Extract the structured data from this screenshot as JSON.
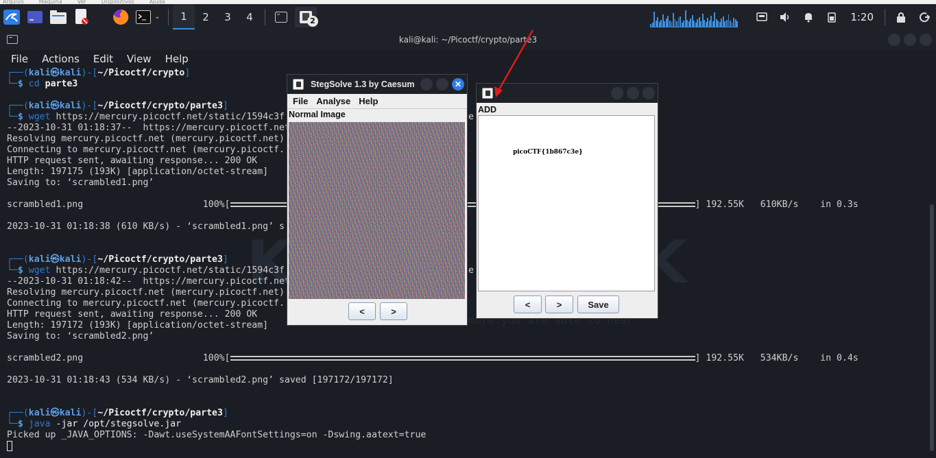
{
  "vbox_menu": [
    "Arquivo",
    "Máquina",
    "Ver",
    "Dispositivos",
    "Ajuda"
  ],
  "panel": {
    "workspaces": [
      "1",
      "2",
      "3",
      "4"
    ],
    "active_workspace": "1",
    "app_badge": "2",
    "clock": "1:20",
    "accent": "#3d8fe0",
    "netgraph": [
      4,
      6,
      22,
      9,
      14,
      7,
      10,
      18,
      8,
      12,
      16,
      9,
      7,
      20,
      11,
      8,
      13,
      15,
      6,
      9,
      24,
      10,
      8,
      12,
      17,
      9,
      6,
      11,
      14,
      8,
      19,
      10,
      7,
      13,
      9,
      16,
      8,
      21,
      11,
      9,
      7,
      12,
      15,
      8,
      10,
      18,
      9,
      6,
      13,
      11,
      8
    ]
  },
  "terminal": {
    "title": "kali@kali: ~/Picoctf/crypto/parte3",
    "menu": [
      "File",
      "Actions",
      "Edit",
      "View",
      "Help"
    ],
    "lines": [
      {
        "k": "prompt",
        "path": "~/Picoctf/crypto",
        "cmd": "cd",
        "arg": "parte3"
      },
      {
        "k": "blank"
      },
      {
        "k": "prompt",
        "path": "~/Picoctf/crypto/parte3",
        "cmd": "wget",
        "arg": "https://mercury.picoctf.net/static/1594c3f"
      },
      {
        "k": "text",
        "t": "--2023-10-31 01:18:37--  https://mercury.picoctf.net"
      },
      {
        "k": "text",
        "t": "Resolving mercury.picoctf.net (mercury.picoctf.net)"
      },
      {
        "k": "text",
        "t": "Connecting to mercury.picoctf.net (mercury.picoctf."
      },
      {
        "k": "text",
        "t": "HTTP request sent, awaiting response... 200 OK"
      },
      {
        "k": "text",
        "t": "Length: 197175 (193K) [application/octet-stream]"
      },
      {
        "k": "text",
        "t": "Saving to: ‘scrambled1.png’"
      },
      {
        "k": "blank"
      },
      {
        "k": "progress",
        "t": "scrambled1.png                      100%[",
        "end": "] 192.55K   610KB/s    in 0.3s"
      },
      {
        "k": "blank"
      },
      {
        "k": "text",
        "t": "2023-10-31 01:18:38 (610 KB/s) - ‘scrambled1.png’ s"
      },
      {
        "k": "blank"
      },
      {
        "k": "blank"
      },
      {
        "k": "prompt",
        "path": "~/Picoctf/crypto/parte3",
        "cmd": "wget",
        "arg": "https://mercury.picoctf.net/static/1594c3f"
      },
      {
        "k": "text",
        "t": "--2023-10-31 01:18:42--  https://mercury.picoctf.net"
      },
      {
        "k": "text",
        "t": "Resolving mercury.picoctf.net (mercury.picoctf.net)"
      },
      {
        "k": "text",
        "t": "Connecting to mercury.picoctf.net (mercury.picoctf."
      },
      {
        "k": "text",
        "t": "HTTP request sent, awaiting response... 200 OK"
      },
      {
        "k": "text",
        "t": "Length: 197172 (193K) [application/octet-stream]"
      },
      {
        "k": "text",
        "t": "Saving to: ‘scrambled2.png’"
      },
      {
        "k": "blank"
      },
      {
        "k": "progress",
        "t": "scrambled2.png                      100%[",
        "end": "] 192.55K   534KB/s    in 0.4s"
      },
      {
        "k": "blank"
      },
      {
        "k": "text",
        "t": "2023-10-31 01:18:43 (534 KB/s) - ‘scrambled2.png’ saved [197172/197172]"
      },
      {
        "k": "blank"
      },
      {
        "k": "blank"
      },
      {
        "k": "prompt",
        "path": "~/Picoctf/crypto/parte3",
        "cmd": "java",
        "arg": "-jar /opt/stegsolve.jar"
      },
      {
        "k": "text",
        "t": "Picked up _JAVA_OPTIONS: -Dawt.useSystemAAFontSettings=on -Dswing.aatext=true"
      },
      {
        "k": "cursor"
      }
    ],
    "user": "kali",
    "host": "kali",
    "side_fragments": [
      {
        "line": 3,
        "t": "e"
      },
      {
        "line": 15,
        "t": "e"
      },
      {
        "line": 16,
        "t": "e"
      }
    ],
    "watermark_tagline": "more you are able to hear\""
  },
  "stegsolve": {
    "title": "StegSolve 1.3 by Caesum",
    "menu": [
      "File",
      "Analyse",
      "Help"
    ],
    "label": "Normal Image",
    "prev": "<",
    "next": ">"
  },
  "combine": {
    "label": "ADD",
    "flag_text": "picoCTF{1b867c3e}",
    "prev": "<",
    "next": ">",
    "save": "Save"
  }
}
